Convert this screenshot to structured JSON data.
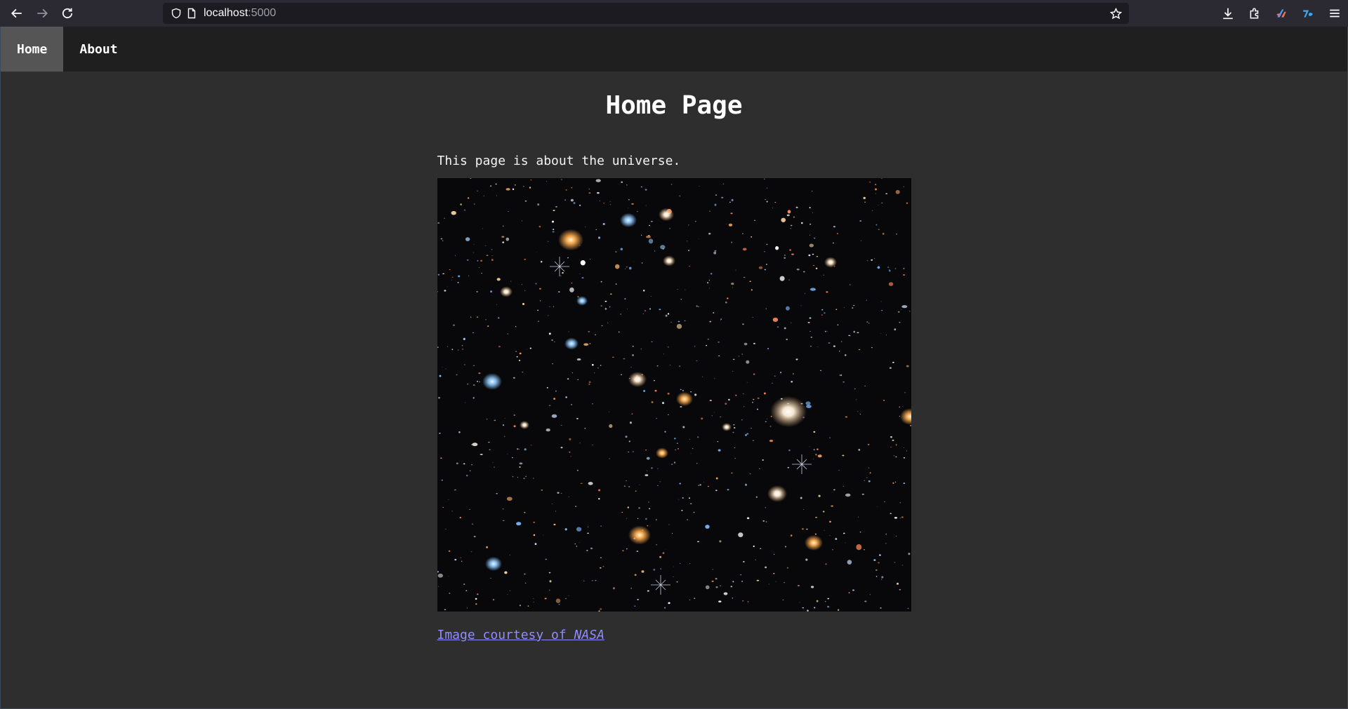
{
  "browser": {
    "url_host": "localhost",
    "url_port": ":5000"
  },
  "nav": {
    "items": [
      {
        "label": "Home"
      },
      {
        "label": "About"
      }
    ]
  },
  "page": {
    "title": "Home Page",
    "intro": "This page is about the universe.",
    "image_alt": "Hubble Ultra Deep Field",
    "credit_prefix": "Image courtesy of ",
    "credit_source": "NASA"
  },
  "colors": {
    "link": "#8f8cff",
    "nav_active": "#555555",
    "page_bg": "#2e2e2e"
  }
}
